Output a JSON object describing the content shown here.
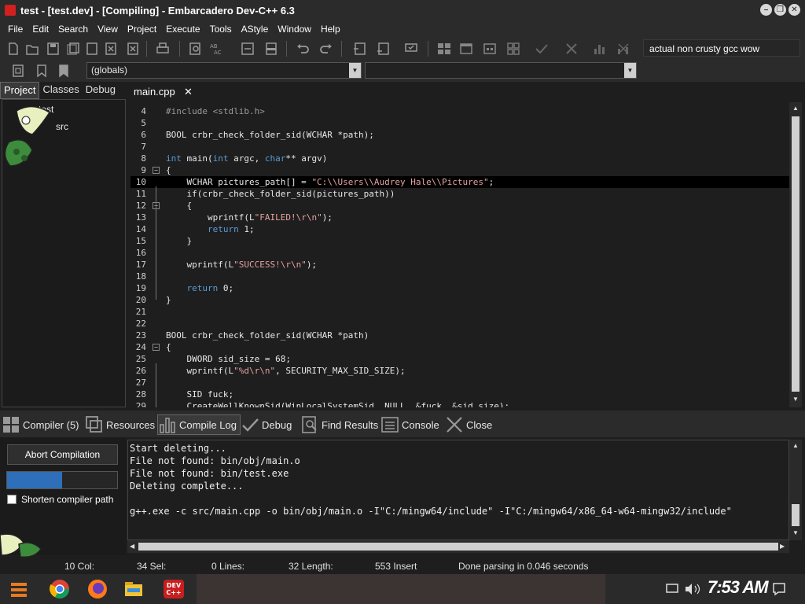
{
  "window": {
    "title": "test - [test.dev] - [Compiling] - Embarcadero Dev-C++ 6.3",
    "logo_text": "DEV C++"
  },
  "menu": [
    "File",
    "Edit",
    "Search",
    "View",
    "Project",
    "Execute",
    "Tools",
    "AStyle",
    "Window",
    "Help"
  ],
  "toolbar": {
    "compiler_set": "actual non crusty gcc wow",
    "scope": "(globals)",
    "function": ""
  },
  "left_panel": {
    "tabs": [
      "Project",
      "Classes",
      "Debug"
    ],
    "active_tab": "Project",
    "tree": {
      "project": "test",
      "folder": "src"
    }
  },
  "editor": {
    "tab_label": "main.cpp",
    "close_glyph": "✕",
    "current_line": 10,
    "lines": [
      {
        "n": "4",
        "text": "#include <stdlib.h>"
      },
      {
        "n": "5",
        "text": ""
      },
      {
        "n": "6",
        "text": "BOOL crbr_check_folder_sid(WCHAR *path);"
      },
      {
        "n": "7",
        "text": ""
      },
      {
        "n": "8",
        "text": "int main(int argc, char** argv)"
      },
      {
        "n": "9",
        "text": "{"
      },
      {
        "n": "10",
        "text": "    WCHAR pictures_path[] = \"C:\\\\Users\\\\Audrey Hale\\\\Pictures\";"
      },
      {
        "n": "11",
        "text": "    if(crbr_check_folder_sid(pictures_path))"
      },
      {
        "n": "12",
        "text": "    {"
      },
      {
        "n": "13",
        "text": "        wprintf(L\"FAILED!\\r\\n\");"
      },
      {
        "n": "14",
        "text": "        return 1;"
      },
      {
        "n": "15",
        "text": "    }"
      },
      {
        "n": "16",
        "text": ""
      },
      {
        "n": "17",
        "text": "    wprintf(L\"SUCCESS!\\r\\n\");"
      },
      {
        "n": "18",
        "text": ""
      },
      {
        "n": "19",
        "text": "    return 0;"
      },
      {
        "n": "20",
        "text": "}"
      },
      {
        "n": "21",
        "text": ""
      },
      {
        "n": "22",
        "text": ""
      },
      {
        "n": "23",
        "text": "BOOL crbr_check_folder_sid(WCHAR *path)"
      },
      {
        "n": "24",
        "text": "{"
      },
      {
        "n": "25",
        "text": "    DWORD sid_size = 68;"
      },
      {
        "n": "26",
        "text": "    wprintf(L\"%d\\r\\n\", SECURITY_MAX_SID_SIZE);"
      },
      {
        "n": "27",
        "text": ""
      },
      {
        "n": "28",
        "text": "    SID fuck;"
      },
      {
        "n": "29",
        "text": "    CreateWellKnownSid(WinLocalSystemSid, NULL, &fuck, &sid_size);"
      }
    ]
  },
  "bottom_tabs": [
    {
      "label": "Compiler (5)",
      "icon": "grid-icon"
    },
    {
      "label": "Resources",
      "icon": "resources-icon"
    },
    {
      "label": "Compile Log",
      "icon": "chart-icon"
    },
    {
      "label": "Debug",
      "icon": "check-icon"
    },
    {
      "label": "Find Results",
      "icon": "find-icon"
    },
    {
      "label": "Console",
      "icon": "console-icon"
    },
    {
      "label": "Close",
      "icon": "close-icon"
    }
  ],
  "compile": {
    "abort_label": "Abort Compilation",
    "progress": 0.5,
    "shorten_label": "Shorten compiler path",
    "shorten_checked": false,
    "log": [
      "Start deleting...",
      "File not found: bin/obj/main.o",
      "File not found: bin/test.exe",
      "Deleting complete...",
      "",
      "g++.exe -c src/main.cpp -o bin/obj/main.o -I\"C:/mingw64/include\" -I\"C:/mingw64/x86_64-w64-mingw32/include\""
    ]
  },
  "status": {
    "col": "10 Col:",
    "sel": "34 Sel:",
    "lines": "0 Lines:",
    "length": "32 Length:",
    "insert": "553 Insert",
    "message": "Done parsing in 0.046 seconds"
  },
  "taskbar": {
    "clock": "7:53 AM"
  },
  "colors": {
    "keyword": "#5a9bd5",
    "string": "#e6a0a0",
    "progress": "#2f6fba",
    "background": "#1e1e1e"
  }
}
